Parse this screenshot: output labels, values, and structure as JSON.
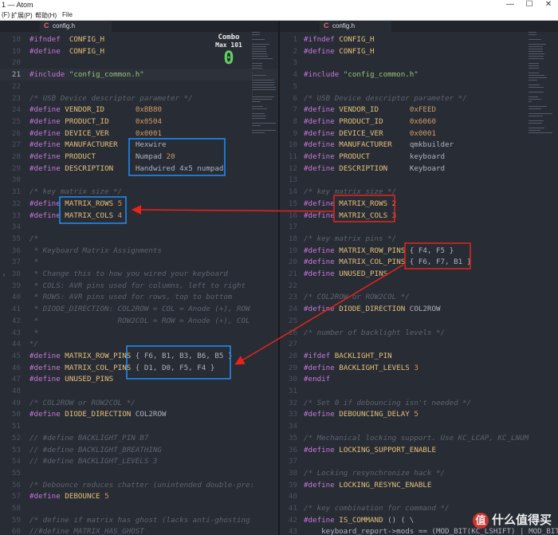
{
  "window": {
    "title": "1 — Atom",
    "controls": [
      "—",
      "☐",
      "✕"
    ]
  },
  "menu": [
    "(F)",
    "扩展(P)",
    "帮助(H)",
    "File"
  ],
  "left_pane": {
    "tab_label": "config.h",
    "tab_icon": "c-file-icon",
    "current_line": 21,
    "lines": [
      {
        "n": 18,
        "parts": [
          [
            "kw",
            "#ifndef"
          ],
          [
            "",
            "  "
          ],
          [
            "mac",
            "CONFIG_H"
          ]
        ]
      },
      {
        "n": 19,
        "parts": [
          [
            "kw",
            "#define"
          ],
          [
            "",
            "  "
          ],
          [
            "mac",
            "CONFIG_H"
          ]
        ]
      },
      {
        "n": 20,
        "parts": []
      },
      {
        "n": 21,
        "parts": [
          [
            "kw",
            "#include"
          ],
          [
            "",
            ""
          ],
          [
            "str",
            " \"config_common.h\""
          ]
        ]
      },
      {
        "n": 22,
        "parts": []
      },
      {
        "n": 23,
        "parts": [
          [
            "cm",
            "/* USB Device descriptor parameter */"
          ]
        ]
      },
      {
        "n": 24,
        "parts": [
          [
            "kw",
            "#define"
          ],
          [
            "",
            " "
          ],
          [
            "mac",
            "VENDOR_ID"
          ],
          [
            "",
            "       "
          ],
          [
            "num",
            "0xBB80"
          ]
        ]
      },
      {
        "n": 25,
        "parts": [
          [
            "kw",
            "#define"
          ],
          [
            "",
            " "
          ],
          [
            "mac",
            "PRODUCT_ID"
          ],
          [
            "",
            "      "
          ],
          [
            "num",
            "0x0504"
          ]
        ]
      },
      {
        "n": 26,
        "parts": [
          [
            "kw",
            "#define"
          ],
          [
            "",
            " "
          ],
          [
            "mac",
            "DEVICE_VER"
          ],
          [
            "",
            "      "
          ],
          [
            "num",
            "0x0001"
          ]
        ]
      },
      {
        "n": 27,
        "parts": [
          [
            "kw",
            "#define"
          ],
          [
            "",
            " "
          ],
          [
            "mac",
            "MANUFACTURER"
          ],
          [
            "",
            "    "
          ],
          [
            "",
            "Hexwire"
          ]
        ]
      },
      {
        "n": 28,
        "parts": [
          [
            "kw",
            "#define"
          ],
          [
            "",
            " "
          ],
          [
            "mac",
            "PRODUCT"
          ],
          [
            "",
            "         "
          ],
          [
            "",
            "Numpad "
          ],
          [
            "num",
            "20"
          ]
        ]
      },
      {
        "n": 29,
        "parts": [
          [
            "kw",
            "#define"
          ],
          [
            "",
            " "
          ],
          [
            "mac",
            "DESCRIPTION"
          ],
          [
            "",
            "     "
          ],
          [
            "",
            "Handwired 4x5 numpad"
          ]
        ]
      },
      {
        "n": 30,
        "parts": []
      },
      {
        "n": 31,
        "parts": [
          [
            "cm",
            "/* key matrix size */"
          ]
        ]
      },
      {
        "n": 32,
        "parts": [
          [
            "kw",
            "#define"
          ],
          [
            "",
            " "
          ],
          [
            "mac",
            "MATRIX_ROWS"
          ],
          [
            "",
            ""
          ],
          [
            "num",
            " 5"
          ]
        ]
      },
      {
        "n": 33,
        "parts": [
          [
            "kw",
            "#define"
          ],
          [
            "",
            " "
          ],
          [
            "mac",
            "MATRIX_COLS"
          ],
          [
            "",
            ""
          ],
          [
            "num",
            " 4"
          ]
        ]
      },
      {
        "n": 34,
        "parts": []
      },
      {
        "n": 35,
        "parts": [
          [
            "cm",
            "/*"
          ]
        ]
      },
      {
        "n": 36,
        "parts": [
          [
            "cm",
            " * Keyboard Matrix Assignments"
          ]
        ]
      },
      {
        "n": 37,
        "parts": [
          [
            "cm",
            " *"
          ]
        ]
      },
      {
        "n": 38,
        "parts": [
          [
            "cm",
            " * Change this to how you wired your keyboard"
          ]
        ]
      },
      {
        "n": 39,
        "parts": [
          [
            "cm",
            " * COLS: AVR pins used for columns, left to right"
          ]
        ]
      },
      {
        "n": 40,
        "parts": [
          [
            "cm",
            " * ROWS: AVR pins used for rows, top to bottom"
          ]
        ]
      },
      {
        "n": 41,
        "parts": [
          [
            "cm",
            " * DIODE_DIRECTION: COL2ROW = COL = Anode (+), ROW"
          ]
        ]
      },
      {
        "n": 42,
        "parts": [
          [
            "cm",
            " *                  ROW2COL = ROW = Anode (+), COL"
          ]
        ]
      },
      {
        "n": 43,
        "parts": [
          [
            "cm",
            " *"
          ]
        ]
      },
      {
        "n": 44,
        "parts": [
          [
            "cm",
            "*/"
          ]
        ]
      },
      {
        "n": 45,
        "parts": [
          [
            "kw",
            "#define"
          ],
          [
            "",
            " "
          ],
          [
            "mac",
            "MATRIX_ROW_PINS"
          ],
          [
            "",
            " { F6, B1, B3, B6, B5 }"
          ]
        ]
      },
      {
        "n": 46,
        "parts": [
          [
            "kw",
            "#define"
          ],
          [
            "",
            " "
          ],
          [
            "mac",
            "MATRIX_COL_PINS"
          ],
          [
            "",
            " { D1, D0, F5, F4 }"
          ]
        ]
      },
      {
        "n": 47,
        "parts": [
          [
            "kw",
            "#define"
          ],
          [
            "",
            " "
          ],
          [
            "mac",
            "UNUSED_PINS"
          ]
        ]
      },
      {
        "n": 48,
        "parts": []
      },
      {
        "n": 49,
        "parts": [
          [
            "cm",
            "/* COL2ROW or ROW2COL */"
          ]
        ]
      },
      {
        "n": 50,
        "parts": [
          [
            "kw",
            "#define"
          ],
          [
            "",
            " "
          ],
          [
            "mac",
            "DIODE_DIRECTION"
          ],
          [
            "",
            " COL2ROW"
          ]
        ]
      },
      {
        "n": 51,
        "parts": []
      },
      {
        "n": 52,
        "parts": [
          [
            "cm",
            "// #define BACKLIGHT_PIN B7"
          ]
        ]
      },
      {
        "n": 53,
        "parts": [
          [
            "cm",
            "// #define BACKLIGHT_BREATHING"
          ]
        ]
      },
      {
        "n": 54,
        "parts": [
          [
            "cm",
            "// #define BACKLIGHT_LEVELS 3"
          ]
        ]
      },
      {
        "n": 55,
        "parts": []
      },
      {
        "n": 56,
        "parts": [
          [
            "cm",
            "/* Debounce reduces chatter (unintended double-pre:"
          ]
        ]
      },
      {
        "n": 57,
        "parts": [
          [
            "kw",
            "#define"
          ],
          [
            "",
            " "
          ],
          [
            "mac",
            "DEBOUNCE"
          ],
          [
            "num",
            " 5"
          ]
        ]
      },
      {
        "n": 58,
        "parts": []
      },
      {
        "n": 59,
        "parts": [
          [
            "cm",
            "/* define if matrix has ghost (lacks anti-ghosting"
          ]
        ]
      },
      {
        "n": 60,
        "parts": [
          [
            "cm",
            "//#define MATRIX_HAS_GHOST"
          ]
        ]
      }
    ]
  },
  "right_pane": {
    "tab_label": "config.h",
    "tab_icon": "c-file-icon",
    "lines": [
      {
        "n": 1,
        "parts": [
          [
            "kw",
            "#ifndef"
          ],
          [
            "",
            " "
          ],
          [
            "mac",
            "CONFIG_H"
          ]
        ]
      },
      {
        "n": 2,
        "parts": [
          [
            "kw",
            "#define"
          ],
          [
            "",
            " "
          ],
          [
            "mac",
            "CONFIG_H"
          ]
        ]
      },
      {
        "n": 3,
        "parts": []
      },
      {
        "n": 4,
        "parts": [
          [
            "kw",
            "#include"
          ],
          [
            "str",
            " \"config_common.h\""
          ]
        ]
      },
      {
        "n": 5,
        "parts": []
      },
      {
        "n": 6,
        "parts": [
          [
            "cm",
            "/* USB Device descriptor parameter */"
          ]
        ]
      },
      {
        "n": 7,
        "parts": [
          [
            "kw",
            "#define"
          ],
          [
            "",
            " "
          ],
          [
            "mac",
            "VENDOR_ID"
          ],
          [
            "",
            "       "
          ],
          [
            "num",
            "0xFEED"
          ]
        ]
      },
      {
        "n": 8,
        "parts": [
          [
            "kw",
            "#define"
          ],
          [
            "",
            " "
          ],
          [
            "mac",
            "PRODUCT_ID"
          ],
          [
            "",
            "      "
          ],
          [
            "num",
            "0x6060"
          ]
        ]
      },
      {
        "n": 9,
        "parts": [
          [
            "kw",
            "#define"
          ],
          [
            "",
            " "
          ],
          [
            "mac",
            "DEVICE_VER"
          ],
          [
            "",
            "      "
          ],
          [
            "num",
            "0x0001"
          ]
        ]
      },
      {
        "n": 10,
        "parts": [
          [
            "kw",
            "#define"
          ],
          [
            "",
            " "
          ],
          [
            "mac",
            "MANUFACTURER"
          ],
          [
            "",
            "    "
          ],
          [
            "",
            "qmkbuilder"
          ]
        ]
      },
      {
        "n": 11,
        "parts": [
          [
            "kw",
            "#define"
          ],
          [
            "",
            " "
          ],
          [
            "mac",
            "PRODUCT"
          ],
          [
            "",
            "         "
          ],
          [
            "",
            "keyboard"
          ]
        ]
      },
      {
        "n": 12,
        "parts": [
          [
            "kw",
            "#define"
          ],
          [
            "",
            " "
          ],
          [
            "mac",
            "DESCRIPTION"
          ],
          [
            "",
            "     "
          ],
          [
            "",
            "Keyboard"
          ]
        ]
      },
      {
        "n": 13,
        "parts": []
      },
      {
        "n": 14,
        "parts": [
          [
            "cm",
            "/* key matrix size */"
          ]
        ]
      },
      {
        "n": 15,
        "parts": [
          [
            "kw",
            "#define"
          ],
          [
            "",
            " "
          ],
          [
            "mac",
            "MATRIX_ROWS"
          ],
          [
            "num",
            " 2"
          ]
        ]
      },
      {
        "n": 16,
        "parts": [
          [
            "kw",
            "#define"
          ],
          [
            "",
            " "
          ],
          [
            "mac",
            "MATRIX_COLS"
          ],
          [
            "num",
            " 3"
          ]
        ]
      },
      {
        "n": 17,
        "parts": []
      },
      {
        "n": 18,
        "parts": [
          [
            "cm",
            "/* key matrix pins */"
          ]
        ]
      },
      {
        "n": 19,
        "parts": [
          [
            "kw",
            "#define"
          ],
          [
            "",
            " "
          ],
          [
            "mac",
            "MATRIX_ROW_PINS"
          ],
          [
            "",
            " { F4, F5 }"
          ]
        ]
      },
      {
        "n": 20,
        "parts": [
          [
            "kw",
            "#define"
          ],
          [
            "",
            " "
          ],
          [
            "mac",
            "MATRIX_COL_PINS"
          ],
          [
            "",
            " { F6, F7, B1 }"
          ]
        ]
      },
      {
        "n": 21,
        "parts": [
          [
            "kw",
            "#define"
          ],
          [
            "",
            " "
          ],
          [
            "mac",
            "UNUSED_PINS"
          ]
        ]
      },
      {
        "n": 22,
        "parts": []
      },
      {
        "n": 23,
        "parts": [
          [
            "cm",
            "/* COL2ROW or ROW2COL */"
          ]
        ]
      },
      {
        "n": 24,
        "parts": [
          [
            "kw",
            "#define"
          ],
          [
            "",
            " "
          ],
          [
            "mac",
            "DIODE_DIRECTION"
          ],
          [
            "",
            " COL2ROW"
          ]
        ]
      },
      {
        "n": 25,
        "parts": []
      },
      {
        "n": 26,
        "parts": [
          [
            "cm",
            "/* number of backlight levels */"
          ]
        ]
      },
      {
        "n": 27,
        "parts": []
      },
      {
        "n": 28,
        "parts": [
          [
            "kw",
            "#ifdef"
          ],
          [
            "",
            " "
          ],
          [
            "mac",
            "BACKLIGHT_PIN"
          ]
        ]
      },
      {
        "n": 29,
        "parts": [
          [
            "kw",
            "#define"
          ],
          [
            "",
            " "
          ],
          [
            "mac",
            "BACKLIGHT_LEVELS"
          ],
          [
            "num",
            " 3"
          ]
        ]
      },
      {
        "n": 30,
        "parts": [
          [
            "kw",
            "#endif"
          ]
        ]
      },
      {
        "n": 31,
        "parts": []
      },
      {
        "n": 32,
        "parts": [
          [
            "cm",
            "/* Set 0 if debouncing isn't needed */"
          ]
        ]
      },
      {
        "n": 33,
        "parts": [
          [
            "kw",
            "#define"
          ],
          [
            "",
            " "
          ],
          [
            "mac",
            "DEBOUNCING_DELAY"
          ],
          [
            "num",
            " 5"
          ]
        ]
      },
      {
        "n": 34,
        "parts": []
      },
      {
        "n": 35,
        "parts": [
          [
            "cm",
            "/* Mechanical locking support. Use KC_LCAP, KC_LNUM"
          ]
        ]
      },
      {
        "n": 36,
        "parts": [
          [
            "kw",
            "#define"
          ],
          [
            "",
            " "
          ],
          [
            "mac",
            "LOCKING_SUPPORT_ENABLE"
          ]
        ]
      },
      {
        "n": 37,
        "parts": []
      },
      {
        "n": 38,
        "parts": [
          [
            "cm",
            "/* Locking resynchronize hack */"
          ]
        ]
      },
      {
        "n": 39,
        "parts": [
          [
            "kw",
            "#define"
          ],
          [
            "",
            " "
          ],
          [
            "mac",
            "LOCKING_RESYNC_ENABLE"
          ]
        ]
      },
      {
        "n": 40,
        "parts": []
      },
      {
        "n": 41,
        "parts": [
          [
            "cm",
            "/* key combination for command */"
          ]
        ]
      },
      {
        "n": 42,
        "parts": [
          [
            "kw",
            "#define"
          ],
          [
            "",
            " "
          ],
          [
            "mac",
            "IS_COMMAND"
          ],
          [
            "",
            " () ( \\"
          ]
        ]
      },
      {
        "n": 43,
        "parts": [
          [
            "",
            "    keyboard_report->mods == (MOD_BIT(KC_LSHIFT) | MOD_BIT(KC_RSHIFT)) \\"
          ]
        ]
      }
    ]
  },
  "overlay_badge": {
    "line1": "Combo",
    "line2": "Max 101",
    "digit": "0"
  },
  "annotations": {
    "blue": "#1e90ff",
    "red": "#e8231c"
  },
  "watermark": {
    "text": "值 什么值得买",
    "logo_char": "值",
    "label": "什么值得买"
  },
  "colors": {
    "background": "#282c34",
    "keyword": "#c678dd",
    "macro": "#e5c07b",
    "string": "#98c379",
    "number": "#d19a66",
    "comment": "#5c6370"
  }
}
